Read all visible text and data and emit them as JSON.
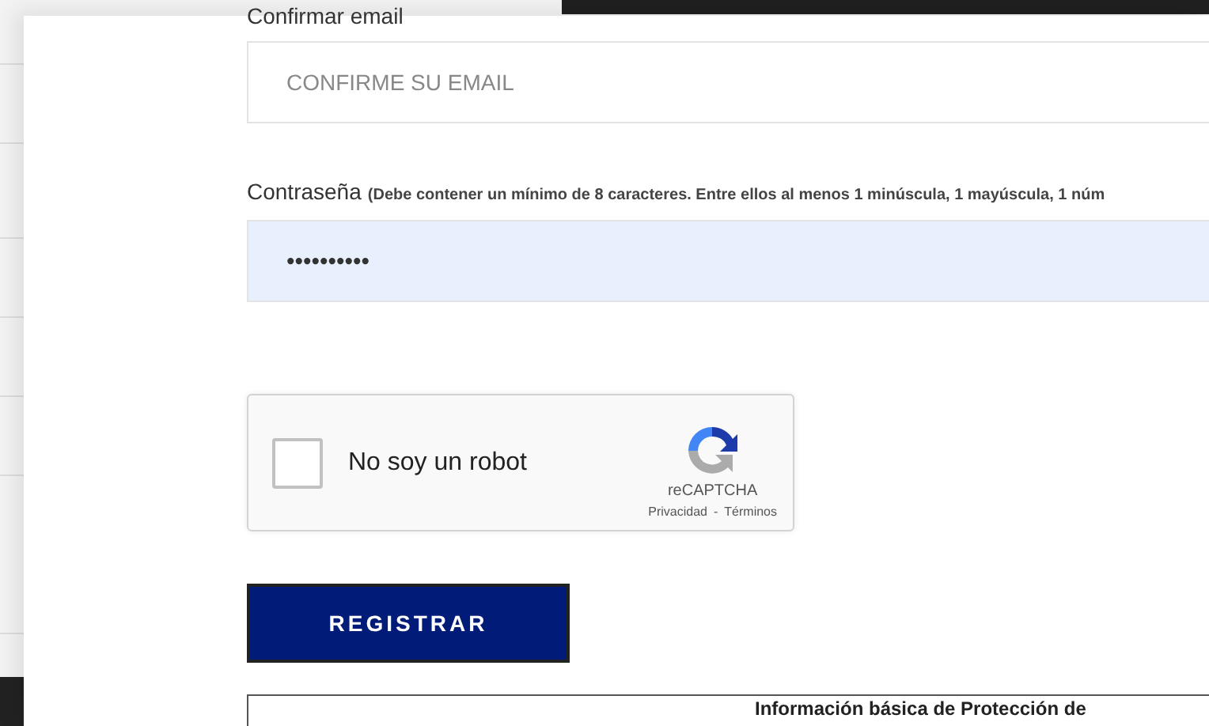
{
  "fields": [
    {
      "kind": "text",
      "label": "Confirmar email",
      "placeholder": "CONFIRME SU EMAIL"
    },
    {
      "kind": "password",
      "label": "Contraseña",
      "hint": "(Debe contener un mínimo de 8 caracteres. Entre ellos al menos 1 minúscula, 1 mayúscula, 1 núm",
      "value": "••••••••••"
    }
  ],
  "captcha": {
    "checked": false,
    "label": "No soy un robot",
    "brand": "reCAPTCHA",
    "privacy": "Privacidad",
    "separator": "-",
    "terms": "Términos"
  },
  "submit": "REGISTRAR",
  "info_table": {
    "heading": "Información básica de Protección de"
  }
}
